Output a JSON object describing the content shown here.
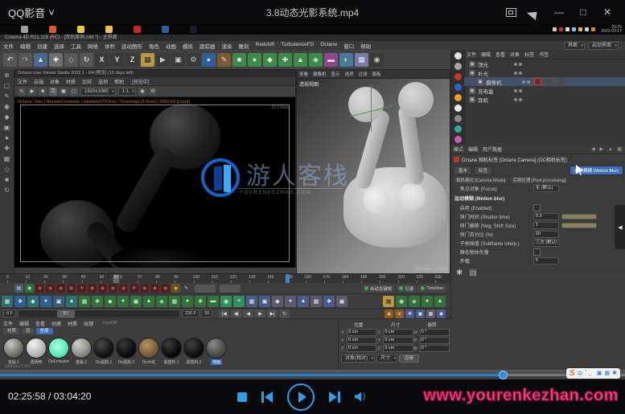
{
  "titlebar": {
    "app": "QQ影音",
    "caret": "˅",
    "filename": "3.8动态光影系统.mp4"
  },
  "taskbar": {
    "apps": [
      "#9aa0a6",
      "#e0582a",
      "#e8c93f",
      "#f2c14e",
      "#c62828",
      "#2c5f9e",
      "#1a1d29"
    ],
    "tray": [
      "#cccccc",
      "#c63333",
      "#dddddd",
      "#66ccff",
      "#f5b041",
      "#cccccc",
      "#e8821e"
    ],
    "clock_time": "20:25",
    "clock_date": "2022-03-17"
  },
  "c4d": {
    "window_title": "Cinema 4D R21.115 (RC) - [耳机案例.c4d *] - 主界面",
    "menus": [
      "文件",
      "编辑",
      "创建",
      "选择",
      "工具",
      "网格",
      "体积",
      "运动图形",
      "角色",
      "动画",
      "模拟",
      "跟踪器",
      "渲染",
      "雕刻",
      "Redshift",
      "TurbulenceFD",
      "Octane",
      "窗口",
      "帮助"
    ],
    "layout_label": "界面",
    "layout_value": "启动界面",
    "toolbar_icons": [
      {
        "g": "↶",
        "c": "#565656",
        "fg": "#d5d5d5"
      },
      {
        "g": "↷",
        "c": "#565656",
        "fg": "#9a9a9a"
      },
      {
        "g": "▲",
        "c": "#47688c",
        "fg": "#dce6f2"
      },
      {
        "g": "✚",
        "c": "#6e6e6e",
        "fg": "#f0f0f0"
      },
      {
        "g": "◇",
        "c": "#565656",
        "fg": "#d5d5d5"
      },
      {
        "g": "↻",
        "c": "#565656",
        "fg": "#d5d5d5"
      },
      {
        "g": "X",
        "c": "#3a3a3a",
        "fg": "#e0e0e0"
      },
      {
        "g": "Y",
        "c": "#3a3a3a",
        "fg": "#e0e0e0"
      },
      {
        "g": "Z",
        "c": "#3a3a3a",
        "fg": "#e0e0e0"
      },
      {
        "g": "▦",
        "c": "#b5983f",
        "fg": "#2a2a2a"
      },
      {
        "g": "▶",
        "c": "#3a3a3a",
        "fg": "#cccccc"
      },
      {
        "g": "▣",
        "c": "#3a3a3a",
        "fg": "#cccccc"
      },
      {
        "g": "⚙",
        "c": "#3a3a3a",
        "fg": "#cccccc"
      },
      {
        "g": "●",
        "c": "#2f5f9a",
        "fg": "#bcd6f0"
      },
      {
        "g": "✎",
        "c": "#7a5a32",
        "fg": "#f0e0c0"
      },
      {
        "g": "■",
        "c": "#3f8a4a",
        "fg": "#d8f0dc"
      },
      {
        "g": "●",
        "c": "#3f8a4a",
        "fg": "#d8f0dc"
      },
      {
        "g": "◆",
        "c": "#3f8a4a",
        "fg": "#d8f0dc"
      },
      {
        "g": "✚",
        "c": "#3f8a4a",
        "fg": "#d8f0dc"
      },
      {
        "g": "▲",
        "c": "#3f8a4a",
        "fg": "#d8f0dc"
      },
      {
        "g": "◈",
        "c": "#3f8a4a",
        "fg": "#d8f0dc"
      },
      {
        "g": "▬",
        "c": "#8a4a8a",
        "fg": "#f0d8f0"
      },
      {
        "g": "◐",
        "c": "#4a7a9a",
        "fg": "#d8ecf8"
      },
      {
        "g": "▦",
        "c": "#7a7aa8",
        "fg": "#e8e8f8"
      },
      {
        "g": "◉",
        "c": "#3a3a3a",
        "fg": "#cccccc"
      }
    ],
    "palette_icons": [
      "⊕",
      "▢",
      "✎",
      "◉",
      "◆",
      "▣",
      "●",
      "✚",
      "▦",
      "◇",
      "■",
      "↻"
    ],
    "live_viewer": {
      "title": "Octane Live Viewer Studio 2022.1 - R4  [预览]  (15 days left)",
      "menus": [
        "文件",
        "云端",
        "对象",
        "材质",
        "比较",
        "选项",
        "帮助"
      ],
      "badge": "[预览中]",
      "resolution": "1920x1080",
      "zoom": "1:1",
      "status": "Octane: 2ms | RenderComplete | Updated(720ms) | Tonemap(15.9ms) | 2000 kS [count]",
      "stats": "15.9 Ms/s",
      "log": "Updated 0 Fts"
    },
    "watermark": {
      "cn": "游人客栈",
      "en": "YOURENKEZHAN.COM"
    },
    "viewport": {
      "menus": [
        "查看",
        "摄像机",
        "显示",
        "选项",
        "过滤",
        "面板"
      ],
      "label": "透视视图",
      "lod": "Animate : 100%"
    },
    "object_manager": {
      "menus": [
        "文件",
        "编辑",
        "查看",
        "对象",
        "标签",
        "书签"
      ],
      "strip": [
        "#e0e0e0",
        "#a8a8a8",
        "#c23a2a",
        "#2a66c2",
        "#e8a020",
        "#ececec",
        "#8a8a8a",
        "#35a8a0",
        "#c858b8"
      ],
      "rows": [
        {
          "g": "◉",
          "name": "顶光",
          "indent": 0,
          "sel": false
        },
        {
          "g": "◉",
          "name": "补光",
          "indent": 0,
          "sel": false
        },
        {
          "g": "▣",
          "name": "摄像机",
          "indent": 1,
          "sel": true
        },
        {
          "g": "▦",
          "name": "充电盒",
          "indent": 0,
          "sel": false
        },
        {
          "g": "▦",
          "name": "耳机",
          "indent": 0,
          "sel": false
        }
      ]
    },
    "attribute_manager": {
      "menus": [
        "模式",
        "编辑",
        "用户数据"
      ],
      "arrows": "◀ ▶ ▲ ▦",
      "title": "Octane 相机标签 [Octane Camera] (OC相机标签)",
      "tabs": [
        "基本",
        "标签"
      ],
      "tab_active": "运动模糊 (Motion Blur)",
      "subtabs": [
        "相机模式 [Camera Mode]",
        "后期处理 [Post processing]"
      ],
      "top_row": {
        "label": "焦点对象 (Focus)",
        "value": "无 (默认)"
      },
      "section": "运动模糊 (Motion blur)",
      "params": [
        {
          "label": "启用 (Enabled)",
          "value": "",
          "check": true,
          "slider": false,
          "box": false
        },
        {
          "label": "快门时间 (Shutter time)",
          "value": "0.3",
          "check": false,
          "slider": true,
          "box": true
        },
        {
          "label": "快门偏移 (Neg. Shift Size)",
          "value": "1",
          "check": false,
          "slider": true,
          "box": true
        },
        {
          "label": "快门百分比 (%)",
          "value": "20",
          "check": false,
          "slider": false,
          "box": true
        },
        {
          "label": "子帧插值 (Subframe interp.)",
          "value": "三次 (默认)",
          "check": false,
          "slider": false,
          "box": true
        },
        {
          "label": "静态物体矢量",
          "value": "( )",
          "check": true,
          "slider": false,
          "box": false
        },
        {
          "label": "步幅",
          "value": "0",
          "check": false,
          "slider": false,
          "box": true
        }
      ],
      "bottom_icons": [
        "✱",
        "▤"
      ]
    },
    "timeline": {
      "ticks": [
        {
          "label": "0",
          "pos": "1.4%"
        },
        {
          "label": "10",
          "pos": "5.6%"
        },
        {
          "label": "20",
          "pos": "9.7%"
        },
        {
          "label": "30",
          "pos": "13.8%"
        },
        {
          "label": "40",
          "pos": "18.0%"
        },
        {
          "label": "50",
          "pos": "22.1%"
        },
        {
          "label": "60",
          "pos": "26.2%"
        },
        {
          "label": "70",
          "pos": "30.4%"
        },
        {
          "label": "80",
          "pos": "34.5%"
        },
        {
          "label": "90",
          "pos": "38.6%"
        },
        {
          "label": "100",
          "pos": "42.8%"
        },
        {
          "label": "110",
          "pos": "46.9%"
        },
        {
          "label": "120",
          "pos": "51.0%"
        },
        {
          "label": "130",
          "pos": "55.2%"
        },
        {
          "label": "140",
          "pos": "59.3%"
        },
        {
          "label": "150",
          "pos": "63.5%"
        },
        {
          "label": "160",
          "pos": "67.6%"
        },
        {
          "label": "170",
          "pos": "71.7%"
        },
        {
          "label": "180",
          "pos": "75.9%"
        },
        {
          "label": "190",
          "pos": "80.0%"
        },
        {
          "label": "200",
          "pos": "84.1%"
        },
        {
          "label": "210",
          "pos": "88.3%"
        },
        {
          "label": "220",
          "pos": "92.4%"
        },
        {
          "label": "230",
          "pos": "96.5%"
        }
      ],
      "playhead_frame": "57",
      "playhead_pos": "25.0%",
      "marker_pos": "63.4%",
      "range_start": "0 F",
      "range_end": "230 F",
      "range_fps": "30",
      "handle_pos": "24%"
    },
    "keyrow_icons": [
      {
        "g": "▤",
        "c": "#4a5a6a",
        "fg": "#cfd8e2"
      },
      {
        "g": "◉",
        "c": "#2f6f3a",
        "fg": "#bfe8c5"
      },
      {
        "g": "◉",
        "c": "#4a2020",
        "fg": "#d05050"
      },
      {
        "g": "◉",
        "c": "#4a2020",
        "fg": "#d05050"
      },
      {
        "g": "◆",
        "c": "#4a2020",
        "fg": "#d05050"
      },
      {
        "g": "◉",
        "c": "#4a2020",
        "fg": "#d05050"
      },
      {
        "g": "✚",
        "c": "#4a2020",
        "fg": "#d05050"
      },
      {
        "g": "◉",
        "c": "#4a2020",
        "fg": "#d05050"
      },
      {
        "g": "◆",
        "c": "#4a2020",
        "fg": "#d05050"
      },
      {
        "g": "◉",
        "c": "#4a2020",
        "fg": "#d05050"
      },
      {
        "g": "◉",
        "c": "#4a2020",
        "fg": "#d05050"
      },
      {
        "g": "✚",
        "c": "#4a2020",
        "fg": "#d05050"
      },
      {
        "g": "◉",
        "c": "#4a2020",
        "fg": "#d05050"
      },
      {
        "g": "◆",
        "c": "#4a2020",
        "fg": "#d05050"
      },
      {
        "g": "◉",
        "c": "#4a2020",
        "fg": "#d05050"
      },
      {
        "g": "◆",
        "c": "#6a5020",
        "fg": "#e0b050"
      },
      {
        "g": "✎",
        "c": "#3d3d3d",
        "fg": "#cccccc"
      }
    ],
    "key_toggles": [
      {
        "label": "自动关键帧"
      },
      {
        "label": "记录"
      },
      {
        "label": "Timeline"
      }
    ],
    "palette_row": [
      {
        "g": "▦",
        "c": "#2f6f6f",
        "fg": "#cdeeee"
      },
      {
        "g": "✚",
        "c": "#2f5f8f",
        "fg": "#cfe4f4"
      },
      {
        "g": "◆",
        "c": "#2f6f6f",
        "fg": "#cdeeee"
      },
      {
        "g": "●",
        "c": "#2f5f8f",
        "fg": "#cfe4f4"
      },
      {
        "g": "▣",
        "c": "#3a5a7a",
        "fg": "#cfe4f4"
      },
      {
        "g": "▲",
        "c": "#2f6f6f",
        "fg": "#cdeeee"
      },
      {
        "g": "▦",
        "c": "#35703a",
        "fg": "#cdeecd"
      },
      {
        "g": "✚",
        "c": "#35703a",
        "fg": "#cdeecd"
      },
      {
        "g": "◆",
        "c": "#35703a",
        "fg": "#cdeecd"
      },
      {
        "g": "●",
        "c": "#35703a",
        "fg": "#cdeecd"
      },
      {
        "g": "▣",
        "c": "#35703a",
        "fg": "#cdeecd"
      },
      {
        "g": "▲",
        "c": "#35703a",
        "fg": "#cdeecd"
      },
      {
        "g": "◈",
        "c": "#35703a",
        "fg": "#cdeecd"
      },
      {
        "g": "▦",
        "c": "#35703a",
        "fg": "#cdeecd"
      },
      {
        "g": "●",
        "c": "#35703a",
        "fg": "#cdeecd"
      },
      {
        "g": "✚",
        "c": "#35703a",
        "fg": "#cdeecd"
      },
      {
        "g": "▬",
        "c": "#35703a",
        "fg": "#cdeecd"
      },
      {
        "g": "◉",
        "c": "#2f8f5f",
        "fg": "#d0f0e0"
      },
      {
        "g": "≡",
        "c": "#2f8f5f",
        "fg": "#d0f0e0"
      },
      {
        "g": "▦",
        "c": "#4a5a8a",
        "fg": "#dde4f4"
      },
      {
        "g": "▣",
        "c": "#4a5a8a",
        "fg": "#dde4f4"
      },
      {
        "g": "◆",
        "c": "#5a5a6a",
        "fg": "#e0e0ea"
      },
      {
        "g": "●",
        "c": "#5a5a6a",
        "fg": "#e0e0ea"
      },
      {
        "g": "▲",
        "c": "#4a5a8a",
        "fg": "#dde4f4"
      },
      {
        "g": "▦",
        "c": "#5a5a6a",
        "fg": "#e0e0ea"
      },
      {
        "g": "✚",
        "c": "#4a5a8a",
        "fg": "#dde4f4"
      },
      {
        "g": "▣",
        "c": "#5a5a6a",
        "fg": "#e0e0ea"
      }
    ],
    "palette_row_right": [
      {
        "g": "▦",
        "c": "#b5983f",
        "fg": "#2a2a2a"
      },
      {
        "g": "◉",
        "c": "#35703a",
        "fg": "#cdeecd"
      },
      {
        "g": "◈",
        "c": "#35703a",
        "fg": "#cdeecd"
      },
      {
        "g": "●",
        "c": "#35703a",
        "fg": "#cdeecd"
      },
      {
        "g": "▲",
        "c": "#35703a",
        "fg": "#cdeecd"
      }
    ],
    "transports": [
      {
        "g": "|◀"
      },
      {
        "g": "◀|"
      },
      {
        "g": "◀"
      },
      {
        "g": "▶"
      },
      {
        "g": "▶|"
      },
      {
        "g": "↻"
      }
    ],
    "rowc_right": [
      {
        "g": "◉",
        "c": "#8a5a20",
        "fg": "#f0c080"
      },
      {
        "g": "⊕",
        "c": "#8a5a20",
        "fg": "#f0c080"
      },
      {
        "g": "✚",
        "c": "#4a5a8a",
        "fg": "#dde4f4"
      },
      {
        "g": "▣",
        "c": "#4a5a8a",
        "fg": "#dde4f4"
      },
      {
        "g": "▦",
        "c": "#5a5a6a",
        "fg": "#e0e0ea"
      },
      {
        "g": "◆",
        "c": "#4a5a8a",
        "fg": "#dde4f4"
      }
    ],
    "materials": {
      "menus": [
        "文件",
        "编辑",
        "查看",
        "创建",
        "材质",
        "纹理"
      ],
      "note": "LiveDB",
      "tabs": [
        {
          "label": "材质",
          "active": false
        },
        {
          "label": "层",
          "active": false
        },
        {
          "label": "全部",
          "active": true
        }
      ],
      "items": [
        {
          "name": "金属.1",
          "bg": "radial-gradient(circle at 35% 30%, #c9c9c2, #6f6f68 60%, #3c3c38)",
          "selected": false
        },
        {
          "name": "透明壳",
          "bg": "radial-gradient(circle at 35% 30%, #f2f2f2, #b9b9b9 55%, #7f7f7f)",
          "selected": false
        },
        {
          "name": "OcEmission",
          "bg": "radial-gradient(circle at 45% 40%, #a8ffe0, #5fe8b8 60%, #2fae88)",
          "selected": false
        },
        {
          "name": "金属.2",
          "bg": "radial-gradient(circle at 35% 30%, #cfcfc9, #8a8a84 60%, #4a4a46)",
          "selected": false
        },
        {
          "name": "Oc黑胶.1",
          "bg": "radial-gradient(circle at 35% 30%, #4a4a4a, #141414 60%, #000)",
          "selected": false
        },
        {
          "name": "Oc黑胶.2",
          "bg": "radial-gradient(circle at 35% 30%, #3a3a3a, #0d0d0d 60%, #000)",
          "selected": false
        },
        {
          "name": "Oc木纹",
          "bg": "radial-gradient(circle at 40% 35%, #bb9466, #7a5a38 60%, #4a3420)",
          "selected": false
        },
        {
          "name": "黑塑料.1",
          "bg": "radial-gradient(circle at 35% 30%, #3f3f3f, #0a0a0a 60%, #000)",
          "selected": false
        },
        {
          "name": "黑塑料.2",
          "bg": "radial-gradient(circle at 35% 30%, #444, #101010 60%, #000)",
          "selected": false
        },
        {
          "name": "地面",
          "bg": "radial-gradient(circle at 35% 30%, #8a8a88, #4a4a48 60%, #2c2c2a)",
          "selected": true
        }
      ]
    },
    "coords": {
      "cols": [
        {
          "h": "位置"
        },
        {
          "h": "尺寸"
        },
        {
          "h": "旋转"
        }
      ],
      "fields": [
        {
          "a": "X",
          "av": "0 cm",
          "b": "X",
          "bv": "0 cm",
          "c": "H",
          "cv": "0 °"
        },
        {
          "a": "Y",
          "av": "0 cm",
          "b": "Y",
          "bv": "0 cm",
          "c": "P",
          "cv": "0 °"
        },
        {
          "a": "Z",
          "av": "0 cm",
          "b": "Z",
          "bv": "0 cm",
          "c": "B",
          "cv": "0 °"
        }
      ],
      "drop1": "对象(相对)",
      "drop2": "尺寸",
      "apply": "应用"
    }
  },
  "ime": {
    "logo": "S",
    "glyphs": [
      "中",
      "'",
      "、",
      "▣",
      "▦",
      "✱"
    ]
  },
  "player": {
    "progress_pct": "80.4%",
    "time": "02:25:58 / 03:04:20",
    "watermark": "www.yourenkezhan.com"
  }
}
